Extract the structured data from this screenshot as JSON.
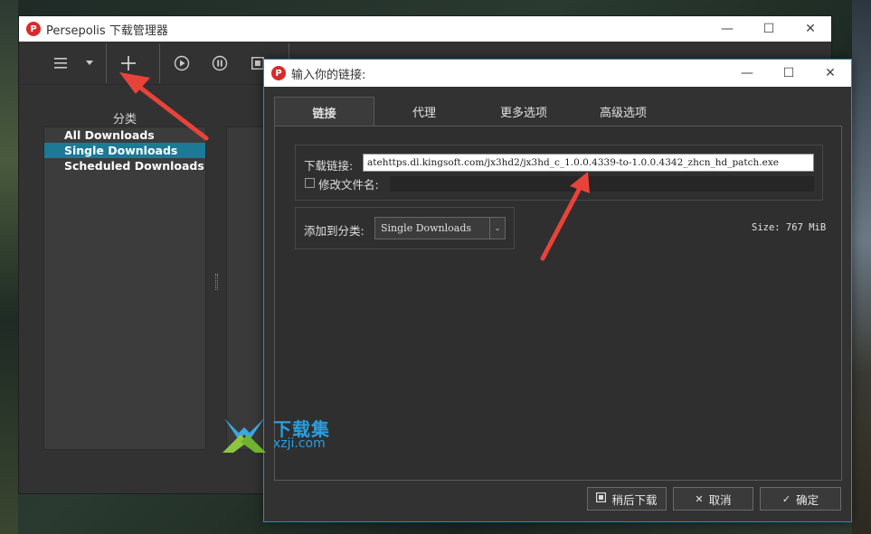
{
  "main_window": {
    "title": "Persepolis 下载管理器",
    "logo_glyph": "P",
    "controls": {
      "minimize": "—",
      "maximize": "☐",
      "close": "✕"
    },
    "category_label": "分类",
    "categories": [
      "All Downloads",
      "Single Downloads",
      "Scheduled Downloads"
    ],
    "selected_category": "Single Downloads"
  },
  "dialog": {
    "title": "输入你的链接:",
    "logo_glyph": "P",
    "controls": {
      "minimize": "—",
      "maximize": "☐",
      "close": "✕"
    },
    "tabs": [
      "链接",
      "代理",
      "更多选项",
      "高级选项"
    ],
    "active_tab": "链接",
    "link_label": "下载链接:",
    "link_value": "atehttps.dl.kingsoft.com/jx3hd2/jx3hd_c_1.0.0.4339-to-1.0.0.4342_zhcn_hd_patch.exe",
    "rename_label": "修改文件名:",
    "rename_checked": false,
    "rename_value": "",
    "addto_label": "添加到分类:",
    "category_selected": "Single Downloads",
    "size_text": "Size: 767 MiB",
    "buttons": {
      "later": "稍后下载",
      "cancel": "取消",
      "ok": "确定"
    }
  },
  "watermark": {
    "text_cn": "下载集",
    "text_url": "xzji.com"
  },
  "colors": {
    "selection": "#1c7a94",
    "arrow": "#e8433a",
    "dialog_border": "#2090c0"
  }
}
